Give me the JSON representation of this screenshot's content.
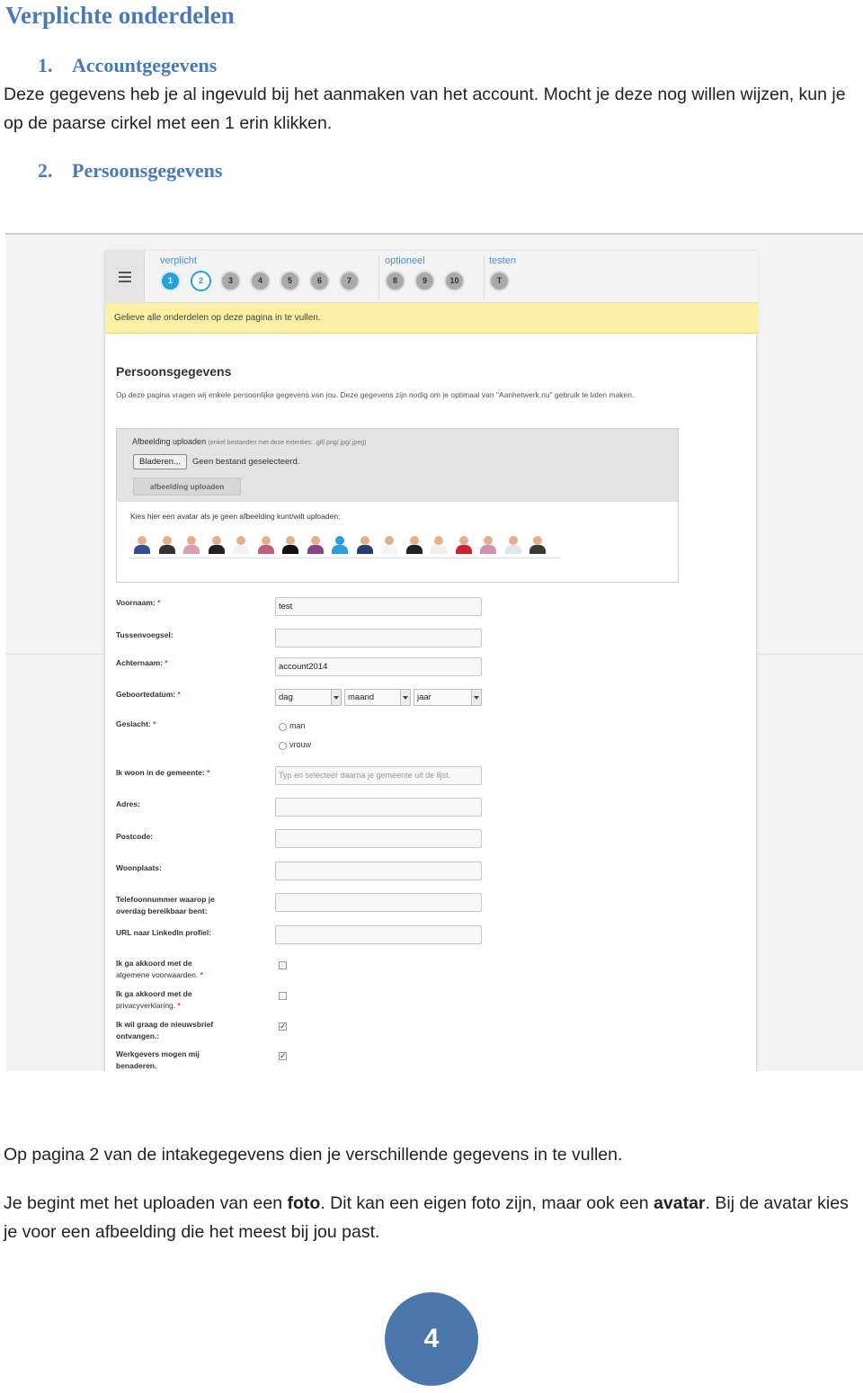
{
  "document": {
    "heading": "Verplichte onderdelen",
    "section1": {
      "number": "1.",
      "title": "Accountgegevens"
    },
    "section1_text": "Deze gegevens heb je al ingevuld bij het aanmaken van het account. Mocht je deze nog willen wijzen, kun je op de paarse cirkel met een 1 erin klikken.",
    "section2": {
      "number": "2.",
      "title": "Persoonsgegevens"
    },
    "para1": "Op pagina  2 van de intakegegevens dien je verschillende gegevens in te vullen.",
    "para2": {
      "part1": "Je begint met het uploaden van een ",
      "bold1": "foto",
      "part2": ". Dit kan een eigen foto zijn, maar ook een ",
      "bold2": "avatar",
      "part3": ". Bij de avatar kies je voor een afbeelding die het meest bij jou past."
    },
    "page_number": "4"
  },
  "screenshot": {
    "nav": {
      "groups": [
        {
          "label": "verplicht",
          "steps": [
            "1",
            "2",
            "3",
            "4",
            "5",
            "6",
            "7"
          ]
        },
        {
          "label": "optioneel",
          "steps": [
            "8",
            "9",
            "10"
          ]
        },
        {
          "label": "testen",
          "steps": [
            "T"
          ]
        }
      ],
      "active_step": "1",
      "current_step": "2"
    },
    "notice": "Gelieve alle onderdelen op deze pagina in te vullen.",
    "section_title": "Persoonsgegevens",
    "section_desc": "Op deze pagina vragen wij enkele persoonlijke gegevens van jou. Deze gegevens zijn nodig om je optimaal van \"Aanhetwerk.nu\" gebruik te laten maken.",
    "upload": {
      "label": "Afbeelding uploaden",
      "hint": "(enkel bestanden met deze extenties: .gif/.png/.jpg/.jpeg)",
      "browse_label": "Bladeren...",
      "no_file": "Geen bestand geselecteerd.",
      "upload_button": "afbeelding uploaden",
      "avatar_label": "Kies hier een avatar als je geen afbeelding kunt/wilt uploaden:",
      "avatar_count": 17
    },
    "form": {
      "required_mark": "*",
      "voornaam": {
        "label": "Voornaam:",
        "value": "test"
      },
      "tussenvoegsel": {
        "label": "Tussenvoegsel:",
        "value": ""
      },
      "achternaam": {
        "label": "Achternaam:",
        "value": "account2014"
      },
      "geboortedatum": {
        "label": "Geboortedatum:",
        "dag": "dag",
        "maand": "maand",
        "jaar": "jaar"
      },
      "geslacht": {
        "label": "Geslacht:",
        "option_man": "man",
        "option_vrouw": "vrouw"
      },
      "gemeente": {
        "label": "Ik woon in de gemeente:",
        "placeholder": "Typ en selecteer daarna je gemeente uit de lijst."
      },
      "adres": {
        "label": "Adres:"
      },
      "postcode": {
        "label": "Postcode:"
      },
      "woonplaats": {
        "label": "Woonplaats:"
      },
      "telefoon": {
        "label_line1": "Telefoonnummer waarop je",
        "label_line2": "overdag bereikbaar bent:"
      },
      "linkedin": {
        "label": "URL naar LinkedIn profiel:"
      },
      "voorwaarden": {
        "line1": "Ik ga akkoord met de",
        "link": "algemene voorwaarden.",
        "checked": false
      },
      "privacy": {
        "line1": "Ik ga akkoord met de",
        "link": "privacyverklaring.",
        "checked": false
      },
      "nieuwsbrief": {
        "line1": "Ik wil graag de nieuwsbrief",
        "line2": "ontvangen.:",
        "checked": true
      },
      "werkgevers": {
        "line1": "Werkgevers mogen mij",
        "line2": "benaderen.",
        "checked": true
      }
    },
    "avatar_colors": [
      "#2f4f8f",
      "#333333",
      "#d9a0b0",
      "#222222",
      "#f2f2f2",
      "#c06080",
      "#111111",
      "#884488",
      "#2a9fd8",
      "#2b3f6f",
      "#f5f5f5",
      "#222222",
      "#f0f0f0",
      "#cc2233",
      "#d090b0",
      "#dde6ee",
      "#3a3a3a"
    ],
    "check_mark": "✓"
  }
}
